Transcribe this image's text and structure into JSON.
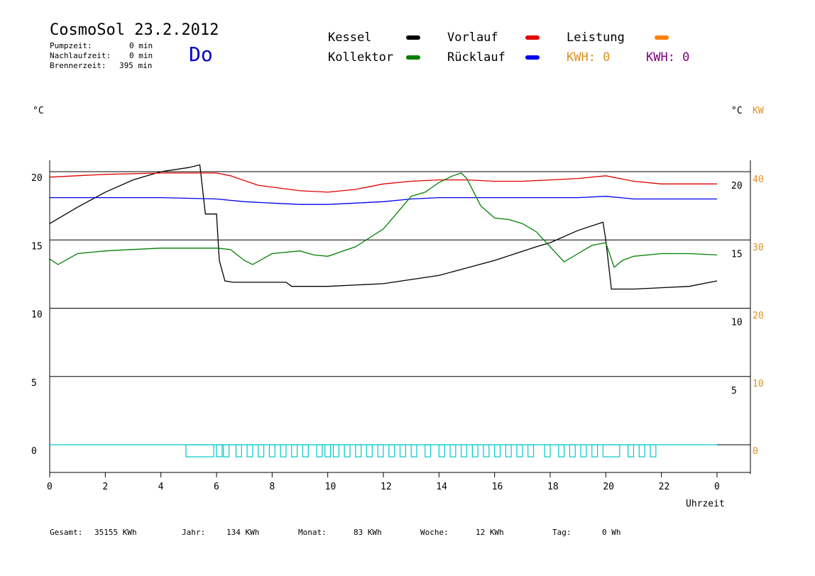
{
  "header": {
    "title": "CosmoSol 23.2.2012",
    "day": "Do",
    "stats": [
      {
        "label": "Pumpzeit:",
        "value": "0 min"
      },
      {
        "label": "Nachlaufzeit:",
        "value": "0 min"
      },
      {
        "label": "Brennerzeit:",
        "value": "395 min"
      }
    ]
  },
  "legend": {
    "kessel": {
      "label": "Kessel",
      "color": "#000000"
    },
    "vorlauf": {
      "label": "Vorlauf",
      "color": "#e00000"
    },
    "leistung": {
      "label": "Leistung",
      "color": "#ff8000"
    },
    "kollektor": {
      "label": "Kollektor",
      "color": "#008000"
    },
    "ruecklauf": {
      "label": "Rücklauf",
      "color": "#0000ee"
    },
    "kwh1": "KWH: 0",
    "kwh2": "KWH: 0",
    "kwh1_color": "#e09020",
    "kwh2_color": "#800080"
  },
  "axes": {
    "left_unit": "°C",
    "right_unit_c": "°C",
    "right_unit_kw": "KW",
    "xlabel": "Uhrzeit"
  },
  "chart_data": {
    "type": "line",
    "xlabel": "Uhrzeit",
    "x_ticks": [
      "0",
      "2",
      "4",
      "6",
      "8",
      "10",
      "12",
      "14",
      "16",
      "18",
      "20",
      "22",
      "0"
    ],
    "y_left_ticks": [
      "20",
      "15",
      "10",
      "5",
      "0"
    ],
    "y_right_c_ticks": [
      "20",
      "15",
      "10",
      "5"
    ],
    "y_right_kw_ticks": [
      "40",
      "30",
      "20",
      "10",
      "0"
    ],
    "xlim": [
      0,
      24
    ],
    "ylim": [
      -1.5,
      21.5
    ],
    "series": [
      {
        "name": "Kessel",
        "color": "#000000",
        "x": [
          0,
          1,
          2,
          3,
          4,
          5,
          5.4,
          5.6,
          6.0,
          6.1,
          6.3,
          6.6,
          8.5,
          8.7,
          10,
          12,
          14,
          16,
          17.5,
          18,
          19,
          19.9,
          20.0,
          20.2,
          21,
          22,
          23,
          24
        ],
        "y": [
          16.2,
          17.4,
          18.5,
          19.4,
          20.0,
          20.3,
          20.5,
          16.9,
          16.9,
          13.5,
          12.0,
          11.9,
          11.9,
          11.6,
          11.6,
          11.8,
          12.4,
          13.5,
          14.5,
          14.8,
          15.7,
          16.3,
          15.0,
          11.4,
          11.4,
          11.5,
          11.6,
          12.0
        ]
      },
      {
        "name": "Vorlauf",
        "color": "#e00000",
        "x": [
          0,
          2,
          4,
          6,
          6.5,
          7.5,
          9,
          10,
          11,
          12,
          13,
          14,
          15,
          16,
          17,
          18,
          19,
          20,
          21,
          22,
          23,
          24
        ],
        "y": [
          19.6,
          19.8,
          19.9,
          19.9,
          19.7,
          19.0,
          18.6,
          18.5,
          18.7,
          19.1,
          19.3,
          19.4,
          19.4,
          19.3,
          19.3,
          19.4,
          19.5,
          19.7,
          19.3,
          19.1,
          19.1,
          19.1
        ]
      },
      {
        "name": "Rücklauf",
        "color": "#0000ee",
        "x": [
          0,
          2,
          4,
          6,
          7,
          8,
          9,
          10,
          11,
          12,
          13,
          14,
          15,
          16,
          17,
          18,
          19,
          20,
          21,
          22,
          23,
          24
        ],
        "y": [
          18.1,
          18.1,
          18.1,
          18.0,
          17.8,
          17.7,
          17.6,
          17.6,
          17.7,
          17.8,
          18.0,
          18.1,
          18.1,
          18.1,
          18.1,
          18.1,
          18.1,
          18.2,
          18.0,
          18.0,
          18.0,
          18.0
        ]
      },
      {
        "name": "Kollektor",
        "color": "#008000",
        "x": [
          0,
          0.3,
          1,
          2,
          3,
          4,
          5,
          6,
          6.5,
          7,
          7.3,
          8,
          9,
          9.5,
          10,
          11,
          12,
          12.5,
          13,
          13.5,
          14,
          14.5,
          14.8,
          15,
          15.5,
          16,
          16.5,
          17,
          17.5,
          18,
          18.5,
          19,
          19.5,
          20,
          20.3,
          20.6,
          21,
          22,
          23,
          24
        ],
        "y": [
          13.6,
          13.2,
          14.0,
          14.2,
          14.3,
          14.4,
          14.4,
          14.4,
          14.3,
          13.5,
          13.2,
          14.0,
          14.2,
          13.9,
          13.8,
          14.5,
          15.8,
          17.0,
          18.2,
          18.5,
          19.2,
          19.7,
          19.9,
          19.5,
          17.5,
          16.6,
          16.5,
          16.2,
          15.6,
          14.5,
          13.4,
          14.0,
          14.6,
          14.8,
          13.0,
          13.5,
          13.8,
          14.0,
          14.0,
          13.9
        ]
      }
    ],
    "pump_signal": {
      "name": "Pumpe",
      "color": "#00c8c8",
      "pulses": [
        [
          4.9,
          5.9
        ],
        [
          6.0,
          6.2
        ],
        [
          6.25,
          6.45
        ],
        [
          6.7,
          6.9
        ],
        [
          7.1,
          7.3
        ],
        [
          7.5,
          7.7
        ],
        [
          7.9,
          8.1
        ],
        [
          8.3,
          8.5
        ],
        [
          8.7,
          8.9
        ],
        [
          9.1,
          9.3
        ],
        [
          9.6,
          9.8
        ],
        [
          9.9,
          10.1
        ],
        [
          10.2,
          10.4
        ],
        [
          10.6,
          10.8
        ],
        [
          11.0,
          11.2
        ],
        [
          11.4,
          11.6
        ],
        [
          11.8,
          12.0
        ],
        [
          12.2,
          12.4
        ],
        [
          12.6,
          12.8
        ],
        [
          13.0,
          13.2
        ],
        [
          13.5,
          13.7
        ],
        [
          14.0,
          14.2
        ],
        [
          14.4,
          14.6
        ],
        [
          14.8,
          15.0
        ],
        [
          15.2,
          15.4
        ],
        [
          15.6,
          15.8
        ],
        [
          16.0,
          16.2
        ],
        [
          16.4,
          16.6
        ],
        [
          16.8,
          17.0
        ],
        [
          17.2,
          17.4
        ],
        [
          17.8,
          18.0
        ],
        [
          18.3,
          18.5
        ],
        [
          18.7,
          18.9
        ],
        [
          19.1,
          19.3
        ],
        [
          19.5,
          19.7
        ],
        [
          19.9,
          20.5
        ],
        [
          20.8,
          21.0
        ],
        [
          21.2,
          21.4
        ],
        [
          21.6,
          21.8
        ]
      ]
    }
  },
  "footer": [
    {
      "label": "Gesamt:",
      "value": "35155 KWh"
    },
    {
      "label": "Jahr:",
      "value": "134 KWh"
    },
    {
      "label": "Monat:",
      "value": "83 KWh"
    },
    {
      "label": "Woche:",
      "value": "12 KWh"
    },
    {
      "label": "Tag:",
      "value": "0 Wh"
    }
  ]
}
